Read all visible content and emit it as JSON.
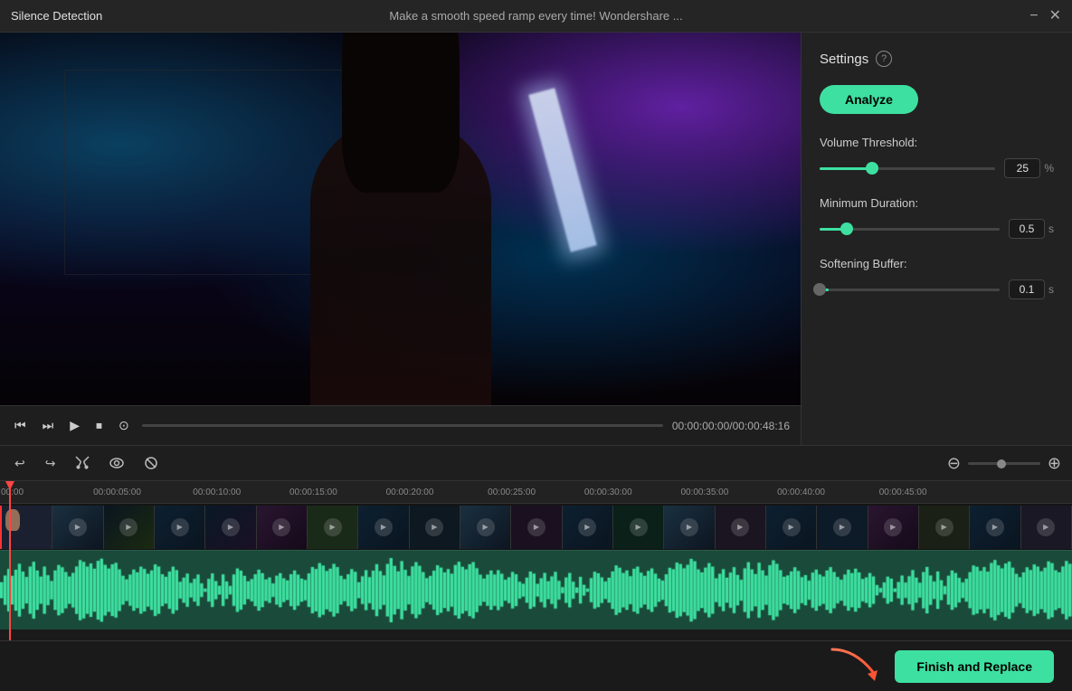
{
  "titlebar": {
    "title": "Silence Detection",
    "subtitle": "Make a smooth speed ramp every time!  Wondershare ...",
    "minimize_label": "−",
    "close_label": "✕"
  },
  "settings": {
    "title": "Settings",
    "help_icon": "?",
    "analyze_label": "Analyze",
    "volume_threshold": {
      "label": "Volume Threshold:",
      "value": "25",
      "unit": "%",
      "fill_percent": 30
    },
    "minimum_duration": {
      "label": "Minimum Duration:",
      "value": "0.5",
      "unit": "s",
      "fill_percent": 15
    },
    "softening_buffer": {
      "label": "Softening Buffer:",
      "value": "0.1",
      "unit": "s",
      "fill_percent": 5
    }
  },
  "video_controls": {
    "time_display": "00:00:00:00/00:00:48:16",
    "progress_fill": 0
  },
  "toolbar": {
    "undo_icon": "↩",
    "redo_icon": "↪",
    "cut_icon": "✂",
    "eye_icon": "👁",
    "mask_icon": "⊘",
    "zoom_minus": "⊖",
    "zoom_plus": "⊕"
  },
  "timeline": {
    "markers": [
      {
        "label": "00:00",
        "position": 0
      },
      {
        "label": "00:00:05:00",
        "position": 8.7
      },
      {
        "label": "00:00:10:00",
        "position": 17.4
      },
      {
        "label": "00:00:15:00",
        "position": 26.1
      },
      {
        "label": "00:00:20:00",
        "position": 34.8
      },
      {
        "label": "00:00:25:00",
        "position": 43.5
      },
      {
        "label": "00:00:30:00",
        "position": 52.2
      },
      {
        "label": "00:00:35:00",
        "position": 60.9
      },
      {
        "label": "00:00:40:00",
        "position": 69.6
      },
      {
        "label": "00:00:45:00",
        "position": 78.3
      }
    ]
  },
  "bottom_bar": {
    "finish_label": "Finish and Replace"
  }
}
